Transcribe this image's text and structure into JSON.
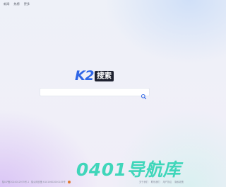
{
  "topnav": [
    "新闻",
    "热榜",
    "更多"
  ],
  "logo": {
    "latin": "K2",
    "cn": "搜索"
  },
  "search": {
    "placeholder": "",
    "value": ""
  },
  "watermark": "0401导航库",
  "footer": {
    "left": [
      "陕ICP备2024012975号-1",
      "陕公网安备 61010602000145号"
    ],
    "right": [
      "关于我们",
      "联系我们",
      "用户协议",
      "隐私政策"
    ]
  },
  "colors": {
    "logo_blue": "#2f66e6",
    "logo_dark": "#1f2230",
    "watermark": "#36d4b6"
  }
}
